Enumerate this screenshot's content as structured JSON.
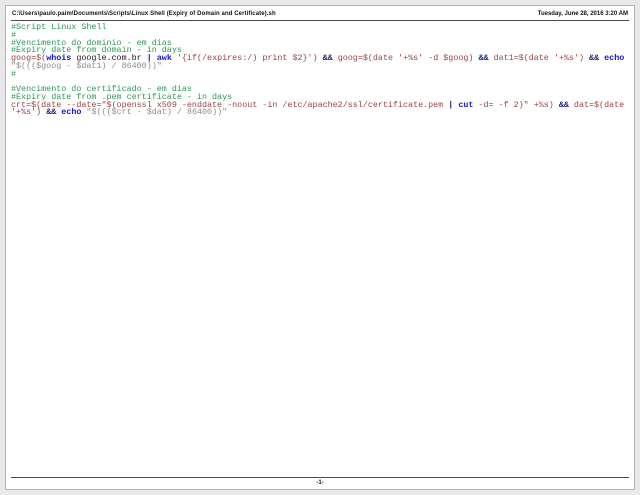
{
  "header": {
    "file_path": "C:\\Users\\paulo.paim\\Documents\\Scripts\\Linux Shell (Expiry of Domain and Certificate).sh",
    "date": "Tuesday, June 28, 2016 3:20 AM"
  },
  "footer": {
    "page_number": "-1-"
  },
  "colors": {
    "comment": "#2e9a54",
    "keyword": "#1414cc",
    "code": "#9c4343",
    "operator": "#15157f",
    "string": "#8c8c8c",
    "default": "#1a1a1a"
  },
  "code": {
    "lines": [
      [
        {
          "t": "comment",
          "s": "#Script Linux Shell"
        }
      ],
      [
        {
          "t": "comment",
          "s": "#"
        }
      ],
      [
        {
          "t": "comment",
          "s": "#Vencimento do dominio - em dias"
        }
      ],
      [
        {
          "t": "comment",
          "s": "#Expiry date from domain - in days"
        }
      ],
      [
        {
          "t": "code",
          "s": "goog=$("
        },
        {
          "t": "keyword",
          "s": "whois"
        },
        {
          "t": "default",
          "s": " google.com.br "
        },
        {
          "t": "operator",
          "s": "|"
        },
        {
          "t": "default",
          "s": " "
        },
        {
          "t": "keyword",
          "s": "awk"
        },
        {
          "t": "code",
          "s": " '{if(/expires:/) print $2}') "
        },
        {
          "t": "operator",
          "s": "&&"
        },
        {
          "t": "code",
          "s": " goog=$(date '+%s' -d $goog) "
        },
        {
          "t": "operator",
          "s": "&&"
        },
        {
          "t": "code",
          "s": " dat1=$(date '+%s') "
        },
        {
          "t": "operator",
          "s": "&&"
        },
        {
          "t": "default",
          "s": " "
        },
        {
          "t": "keyword",
          "s": "echo"
        }
      ],
      [
        {
          "t": "string",
          "s": "\"$((($goog - $dat1) / 86400))\""
        }
      ],
      [
        {
          "t": "comment",
          "s": "#"
        }
      ],
      [],
      [
        {
          "t": "comment",
          "s": "#Vencimento do certificado - em dias"
        }
      ],
      [
        {
          "t": "comment",
          "s": "#Expiry date from .pem certificate - in days"
        }
      ],
      [
        {
          "t": "code",
          "s": "crt=$(date --date=\"$(openssl x509 -enddate -noout -in /etc/apache2/ssl/certificate.pem "
        },
        {
          "t": "operator",
          "s": "|"
        },
        {
          "t": "default",
          "s": " "
        },
        {
          "t": "keyword",
          "s": "cut"
        },
        {
          "t": "code",
          "s": " -d= -f 2)\" +%s) "
        },
        {
          "t": "operator",
          "s": "&&"
        },
        {
          "t": "code",
          "s": " dat=$(date"
        }
      ],
      [
        {
          "t": "code",
          "s": "'+%s') "
        },
        {
          "t": "operator",
          "s": "&&"
        },
        {
          "t": "default",
          "s": " "
        },
        {
          "t": "keyword",
          "s": "echo"
        },
        {
          "t": "default",
          "s": " "
        },
        {
          "t": "string",
          "s": "\"$((($crt - $dat) / 86400))\""
        }
      ]
    ]
  }
}
